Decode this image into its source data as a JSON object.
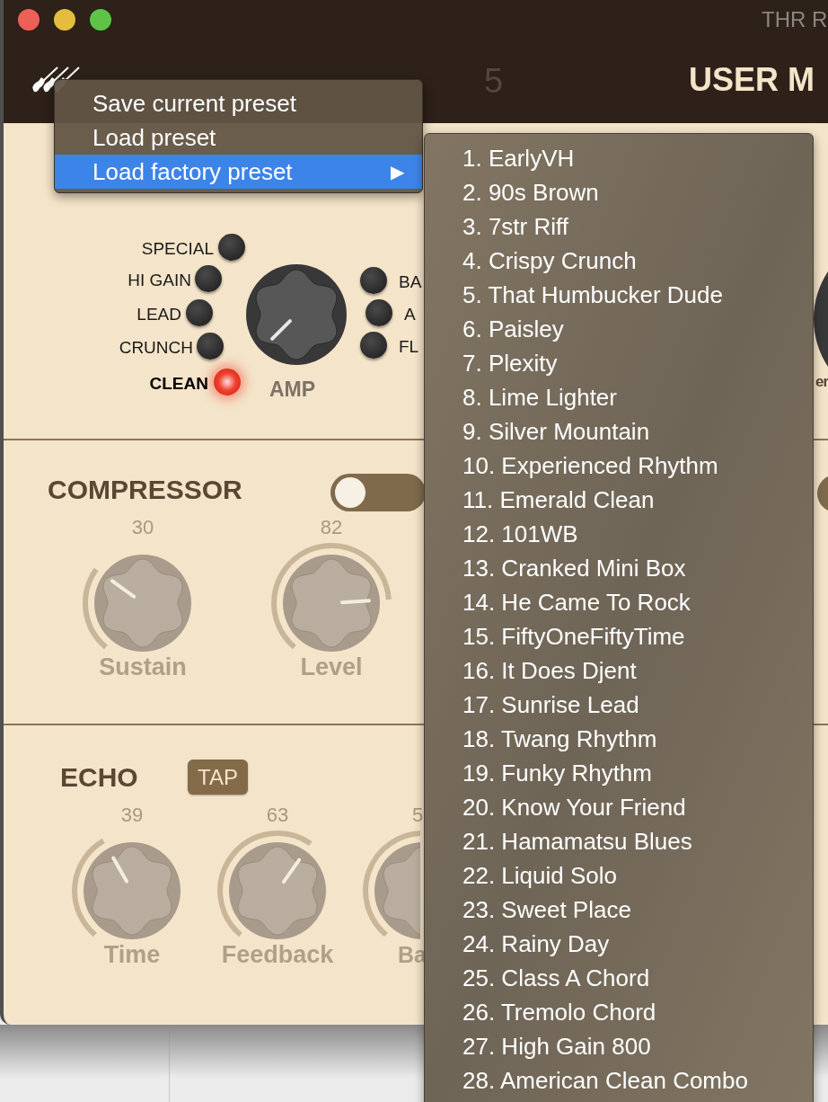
{
  "window": {
    "title": "THR R"
  },
  "header": {
    "tabs": [
      {
        "label": "5",
        "selected": false
      }
    ],
    "bank_label": "USER M"
  },
  "amp": {
    "label": "AMP",
    "left_channels": [
      {
        "label": "SPECIAL",
        "selected": false
      },
      {
        "label": "HI GAIN",
        "selected": false
      },
      {
        "label": "LEAD",
        "selected": false
      },
      {
        "label": "CRUNCH",
        "selected": false
      },
      {
        "label": "CLEAN",
        "selected": true
      }
    ],
    "right_channels": [
      {
        "label": "BA",
        "selected": false
      },
      {
        "label": "A",
        "selected": false
      },
      {
        "label": "FL",
        "selected": false
      }
    ],
    "cut_label": "er"
  },
  "compressor": {
    "title": "COMPRESSOR",
    "on": false,
    "knobs": [
      {
        "label": "Sustain",
        "value": "30"
      },
      {
        "label": "Level",
        "value": "82"
      }
    ]
  },
  "echo": {
    "title": "ECHO",
    "tap_button": "TAP",
    "knobs": [
      {
        "label": "Time",
        "value": "39"
      },
      {
        "label": "Feedback",
        "value": "63"
      },
      {
        "label": "Ba",
        "value": "5"
      }
    ]
  },
  "menu": {
    "items": [
      {
        "label": "Save current preset",
        "selected": false
      },
      {
        "label": "Load preset",
        "selected": false
      },
      {
        "label": "Load factory preset",
        "selected": true,
        "arrow": "▶"
      }
    ]
  },
  "submenu": {
    "items": [
      "1. EarlyVH",
      "2. 90s Brown",
      "3. 7str Riff",
      "4. Crispy Crunch",
      "5. That Humbucker Dude",
      "6. Paisley",
      "7. Plexity",
      "8. Lime Lighter",
      "9. Silver Mountain",
      "10. Experienced Rhythm",
      "11. Emerald Clean",
      "12. 101WB",
      "13. Cranked Mini Box",
      "14. He Came To Rock",
      "15. FiftyOneFiftyTime",
      "16. It Does Djent",
      "17. Sunrise Lead",
      "18. Twang Rhythm",
      "19. Funky Rhythm",
      "20. Know Your Friend",
      "21. Hamamatsu Blues",
      "22. Liquid Solo",
      "23. Sweet Place",
      "24. Rainy Day",
      "25. Class A Chord",
      "26. Tremolo Chord",
      "27. High Gain 800",
      "28. American Clean Combo"
    ]
  }
}
